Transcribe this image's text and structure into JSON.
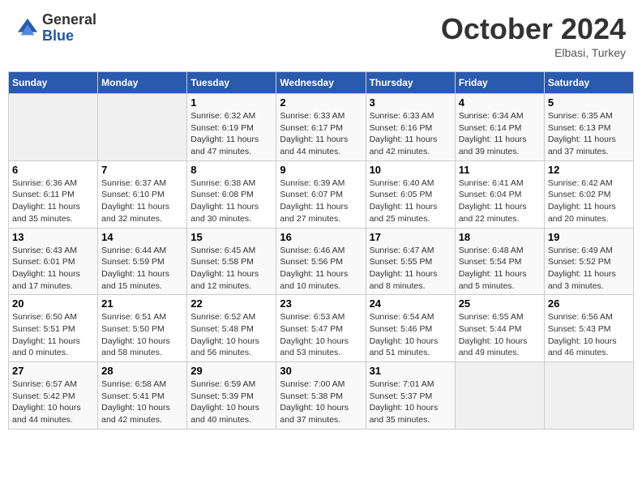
{
  "header": {
    "logo_general": "General",
    "logo_blue": "Blue",
    "month_title": "October 2024",
    "subtitle": "Elbasi, Turkey"
  },
  "days_of_week": [
    "Sunday",
    "Monday",
    "Tuesday",
    "Wednesday",
    "Thursday",
    "Friday",
    "Saturday"
  ],
  "weeks": [
    [
      {
        "day": "",
        "sunrise": "",
        "sunset": "",
        "daylight": ""
      },
      {
        "day": "",
        "sunrise": "",
        "sunset": "",
        "daylight": ""
      },
      {
        "day": "1",
        "sunrise": "Sunrise: 6:32 AM",
        "sunset": "Sunset: 6:19 PM",
        "daylight": "Daylight: 11 hours and 47 minutes."
      },
      {
        "day": "2",
        "sunrise": "Sunrise: 6:33 AM",
        "sunset": "Sunset: 6:17 PM",
        "daylight": "Daylight: 11 hours and 44 minutes."
      },
      {
        "day": "3",
        "sunrise": "Sunrise: 6:33 AM",
        "sunset": "Sunset: 6:16 PM",
        "daylight": "Daylight: 11 hours and 42 minutes."
      },
      {
        "day": "4",
        "sunrise": "Sunrise: 6:34 AM",
        "sunset": "Sunset: 6:14 PM",
        "daylight": "Daylight: 11 hours and 39 minutes."
      },
      {
        "day": "5",
        "sunrise": "Sunrise: 6:35 AM",
        "sunset": "Sunset: 6:13 PM",
        "daylight": "Daylight: 11 hours and 37 minutes."
      }
    ],
    [
      {
        "day": "6",
        "sunrise": "Sunrise: 6:36 AM",
        "sunset": "Sunset: 6:11 PM",
        "daylight": "Daylight: 11 hours and 35 minutes."
      },
      {
        "day": "7",
        "sunrise": "Sunrise: 6:37 AM",
        "sunset": "Sunset: 6:10 PM",
        "daylight": "Daylight: 11 hours and 32 minutes."
      },
      {
        "day": "8",
        "sunrise": "Sunrise: 6:38 AM",
        "sunset": "Sunset: 6:08 PM",
        "daylight": "Daylight: 11 hours and 30 minutes."
      },
      {
        "day": "9",
        "sunrise": "Sunrise: 6:39 AM",
        "sunset": "Sunset: 6:07 PM",
        "daylight": "Daylight: 11 hours and 27 minutes."
      },
      {
        "day": "10",
        "sunrise": "Sunrise: 6:40 AM",
        "sunset": "Sunset: 6:05 PM",
        "daylight": "Daylight: 11 hours and 25 minutes."
      },
      {
        "day": "11",
        "sunrise": "Sunrise: 6:41 AM",
        "sunset": "Sunset: 6:04 PM",
        "daylight": "Daylight: 11 hours and 22 minutes."
      },
      {
        "day": "12",
        "sunrise": "Sunrise: 6:42 AM",
        "sunset": "Sunset: 6:02 PM",
        "daylight": "Daylight: 11 hours and 20 minutes."
      }
    ],
    [
      {
        "day": "13",
        "sunrise": "Sunrise: 6:43 AM",
        "sunset": "Sunset: 6:01 PM",
        "daylight": "Daylight: 11 hours and 17 minutes."
      },
      {
        "day": "14",
        "sunrise": "Sunrise: 6:44 AM",
        "sunset": "Sunset: 5:59 PM",
        "daylight": "Daylight: 11 hours and 15 minutes."
      },
      {
        "day": "15",
        "sunrise": "Sunrise: 6:45 AM",
        "sunset": "Sunset: 5:58 PM",
        "daylight": "Daylight: 11 hours and 12 minutes."
      },
      {
        "day": "16",
        "sunrise": "Sunrise: 6:46 AM",
        "sunset": "Sunset: 5:56 PM",
        "daylight": "Daylight: 11 hours and 10 minutes."
      },
      {
        "day": "17",
        "sunrise": "Sunrise: 6:47 AM",
        "sunset": "Sunset: 5:55 PM",
        "daylight": "Daylight: 11 hours and 8 minutes."
      },
      {
        "day": "18",
        "sunrise": "Sunrise: 6:48 AM",
        "sunset": "Sunset: 5:54 PM",
        "daylight": "Daylight: 11 hours and 5 minutes."
      },
      {
        "day": "19",
        "sunrise": "Sunrise: 6:49 AM",
        "sunset": "Sunset: 5:52 PM",
        "daylight": "Daylight: 11 hours and 3 minutes."
      }
    ],
    [
      {
        "day": "20",
        "sunrise": "Sunrise: 6:50 AM",
        "sunset": "Sunset: 5:51 PM",
        "daylight": "Daylight: 11 hours and 0 minutes."
      },
      {
        "day": "21",
        "sunrise": "Sunrise: 6:51 AM",
        "sunset": "Sunset: 5:50 PM",
        "daylight": "Daylight: 10 hours and 58 minutes."
      },
      {
        "day": "22",
        "sunrise": "Sunrise: 6:52 AM",
        "sunset": "Sunset: 5:48 PM",
        "daylight": "Daylight: 10 hours and 56 minutes."
      },
      {
        "day": "23",
        "sunrise": "Sunrise: 6:53 AM",
        "sunset": "Sunset: 5:47 PM",
        "daylight": "Daylight: 10 hours and 53 minutes."
      },
      {
        "day": "24",
        "sunrise": "Sunrise: 6:54 AM",
        "sunset": "Sunset: 5:46 PM",
        "daylight": "Daylight: 10 hours and 51 minutes."
      },
      {
        "day": "25",
        "sunrise": "Sunrise: 6:55 AM",
        "sunset": "Sunset: 5:44 PM",
        "daylight": "Daylight: 10 hours and 49 minutes."
      },
      {
        "day": "26",
        "sunrise": "Sunrise: 6:56 AM",
        "sunset": "Sunset: 5:43 PM",
        "daylight": "Daylight: 10 hours and 46 minutes."
      }
    ],
    [
      {
        "day": "27",
        "sunrise": "Sunrise: 6:57 AM",
        "sunset": "Sunset: 5:42 PM",
        "daylight": "Daylight: 10 hours and 44 minutes."
      },
      {
        "day": "28",
        "sunrise": "Sunrise: 6:58 AM",
        "sunset": "Sunset: 5:41 PM",
        "daylight": "Daylight: 10 hours and 42 minutes."
      },
      {
        "day": "29",
        "sunrise": "Sunrise: 6:59 AM",
        "sunset": "Sunset: 5:39 PM",
        "daylight": "Daylight: 10 hours and 40 minutes."
      },
      {
        "day": "30",
        "sunrise": "Sunrise: 7:00 AM",
        "sunset": "Sunset: 5:38 PM",
        "daylight": "Daylight: 10 hours and 37 minutes."
      },
      {
        "day": "31",
        "sunrise": "Sunrise: 7:01 AM",
        "sunset": "Sunset: 5:37 PM",
        "daylight": "Daylight: 10 hours and 35 minutes."
      },
      {
        "day": "",
        "sunrise": "",
        "sunset": "",
        "daylight": ""
      },
      {
        "day": "",
        "sunrise": "",
        "sunset": "",
        "daylight": ""
      }
    ]
  ]
}
